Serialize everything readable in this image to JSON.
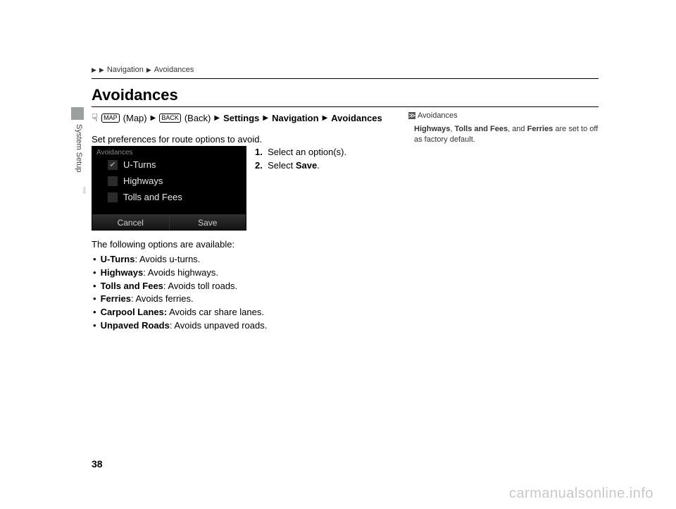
{
  "crumb": {
    "a": "Navigation",
    "b": "Avoidances"
  },
  "heading": "Avoidances",
  "tab_label": "System Setup",
  "navpath": {
    "map": "(Map)",
    "back": "(Back)",
    "settings": "Settings",
    "navigation": "Navigation",
    "avoidances": "Avoidances",
    "map_icon_label": "MAP",
    "back_icon_label": "BACK"
  },
  "intro": "Set preferences for route options to avoid.",
  "screenshot": {
    "title": "Avoidances",
    "rows": [
      "U-Turns",
      "Highways",
      "Tolls and Fees"
    ],
    "checked_index": 0,
    "cancel": "Cancel",
    "save": "Save"
  },
  "steps": {
    "s1_prefix": "1.",
    "s1": "Select an option(s).",
    "s2_prefix": "2.",
    "s2a": "Select ",
    "s2b": "Save",
    "s2c": "."
  },
  "after": {
    "lead": "The following options are available:",
    "items": [
      {
        "b": "U-Turns",
        "t": ": Avoids u-turns."
      },
      {
        "b": "Highways",
        "t": ": Avoids highways."
      },
      {
        "b": "Tolls and Fees",
        "t": ": Avoids toll roads."
      },
      {
        "b": "Ferries",
        "t": ": Avoids ferries."
      },
      {
        "b": "Carpool Lanes:",
        "t": " Avoids car share lanes."
      },
      {
        "b": "Unpaved Roads",
        "t": ": Avoids unpaved roads."
      }
    ]
  },
  "rcol": {
    "heading": "Avoidances",
    "b1": "Highways",
    "t1": ", ",
    "b2": "Tolls and Fees",
    "t2": ", and ",
    "b3": "Ferries",
    "t3": " are set to off as factory default."
  },
  "page_number": "38",
  "watermark": "carmanualsonline.info"
}
